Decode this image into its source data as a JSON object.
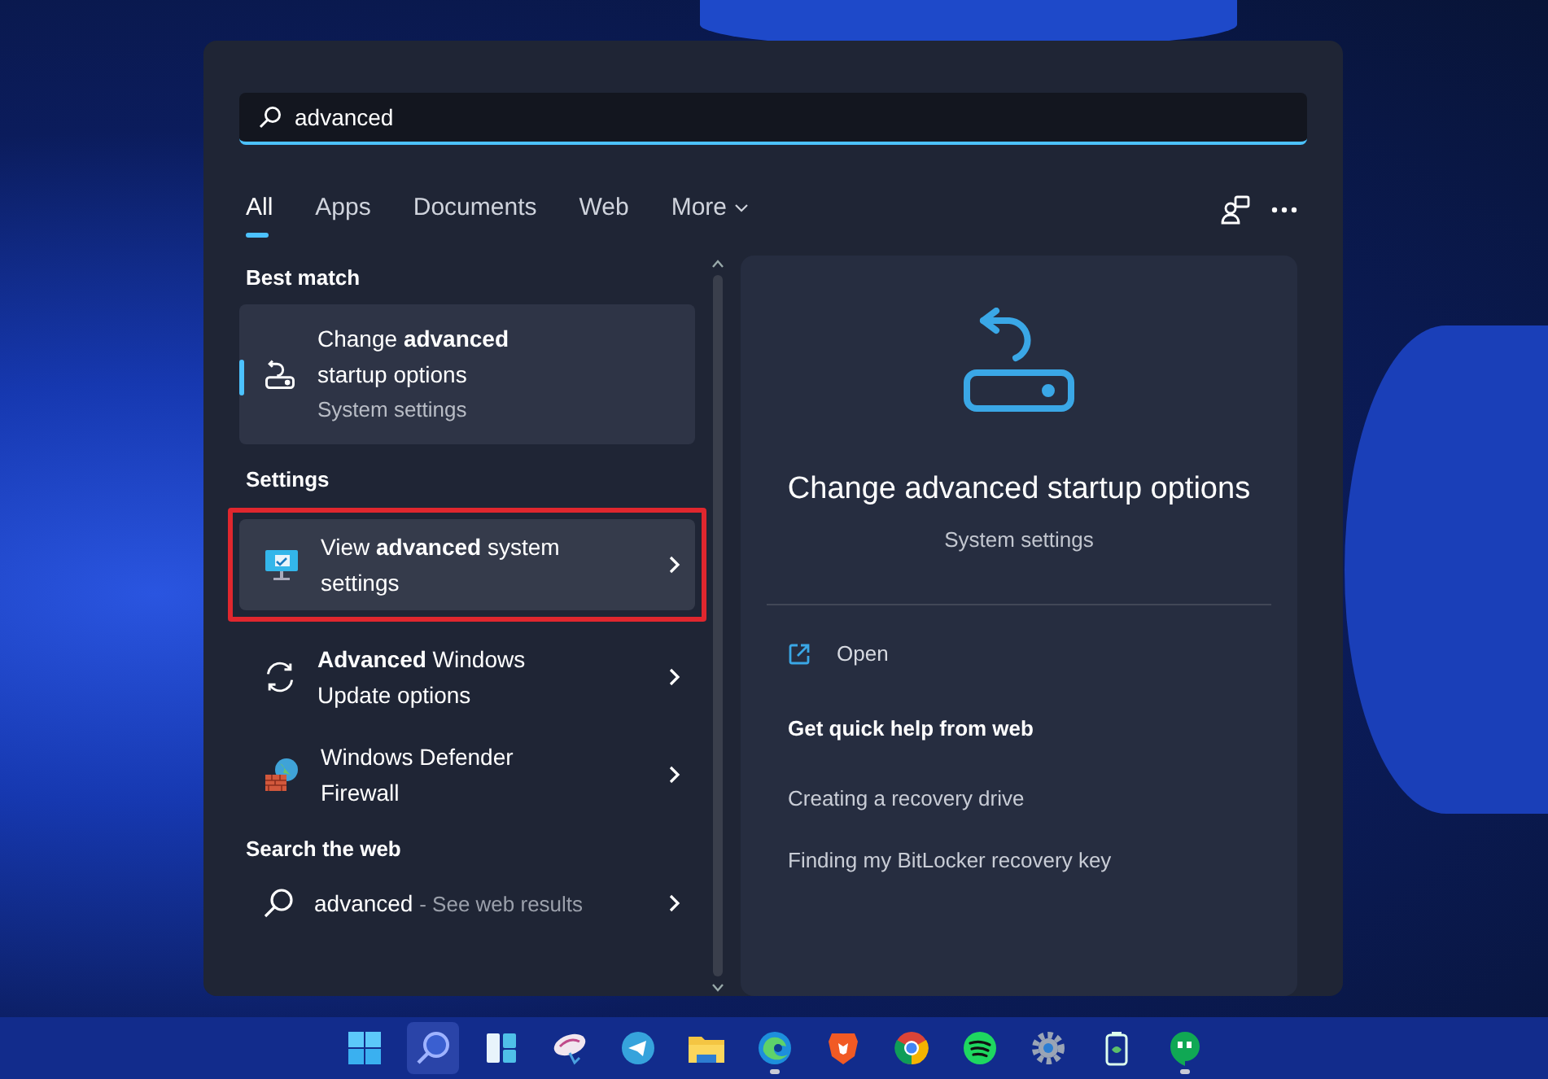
{
  "search": {
    "value": "advanced"
  },
  "tabs": [
    {
      "label": "All",
      "selected": true
    },
    {
      "label": "Apps",
      "selected": false
    },
    {
      "label": "Documents",
      "selected": false
    },
    {
      "label": "Web",
      "selected": false
    },
    {
      "label": "More",
      "selected": false,
      "dropdown": true
    }
  ],
  "sections": [
    {
      "heading": "Best match",
      "items": [
        {
          "kind": "startup",
          "title": "Change **advanced** startup options",
          "subtitle": "System settings",
          "selected": true,
          "outlined": false,
          "arrow": false
        }
      ]
    },
    {
      "heading": "Settings",
      "items": [
        {
          "kind": "display",
          "title": "View **advanced** system settings",
          "selected": false,
          "outlined": true,
          "arrow": true
        },
        {
          "kind": "update",
          "title": "**Advanced** Windows Update options",
          "selected": false,
          "outlined": false,
          "arrow": true
        },
        {
          "kind": "firewall",
          "title": "Windows Defender Firewall",
          "selected": false,
          "outlined": false,
          "arrow": true
        }
      ]
    },
    {
      "heading": "Search the web",
      "items": [
        {
          "kind": "search",
          "title": "advanced",
          "suffix": "- See web results",
          "selected": false,
          "outlined": false,
          "arrow": true
        }
      ]
    }
  ],
  "preview": {
    "title": "Change advanced startup options",
    "subtitle": "System settings",
    "action": "Open",
    "help_heading": "Get quick help from web",
    "links": [
      "Creating a recovery drive",
      "Finding my BitLocker recovery key"
    ]
  },
  "taskbar": [
    {
      "kind": "start",
      "active": false,
      "running": false
    },
    {
      "kind": "search",
      "active": true,
      "running": false
    },
    {
      "kind": "widgets",
      "active": false,
      "running": false
    },
    {
      "kind": "app",
      "active": false,
      "running": false
    },
    {
      "kind": "telegram",
      "active": false,
      "running": false
    },
    {
      "kind": "folder",
      "active": false,
      "running": false
    },
    {
      "kind": "edge",
      "active": false,
      "running": true
    },
    {
      "kind": "brave",
      "active": false,
      "running": false
    },
    {
      "kind": "chrome",
      "active": false,
      "running": false
    },
    {
      "kind": "spotify",
      "active": false,
      "running": false
    },
    {
      "kind": "settings",
      "active": false,
      "running": false
    },
    {
      "kind": "battery",
      "active": false,
      "running": false
    },
    {
      "kind": "hangouts",
      "active": false,
      "running": true
    }
  ]
}
